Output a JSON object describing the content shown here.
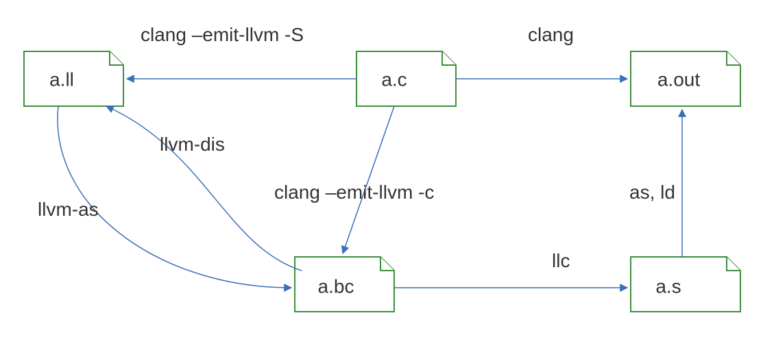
{
  "nodes": {
    "a_ll": {
      "label": "a.ll"
    },
    "a_c": {
      "label": "a.c"
    },
    "a_out": {
      "label": "a.out"
    },
    "a_bc": {
      "label": "a.bc"
    },
    "a_s": {
      "label": "a.s"
    }
  },
  "edges": {
    "c_to_ll": {
      "label": "clang –emit-llvm -S"
    },
    "c_to_out": {
      "label": "clang"
    },
    "c_to_bc": {
      "label": "clang –emit-llvm -c"
    },
    "bc_to_s": {
      "label": "llc"
    },
    "s_to_out": {
      "label": "as, ld"
    },
    "ll_to_bc": {
      "label": "llvm-as"
    },
    "bc_to_ll": {
      "label": "llvm-dis"
    }
  }
}
